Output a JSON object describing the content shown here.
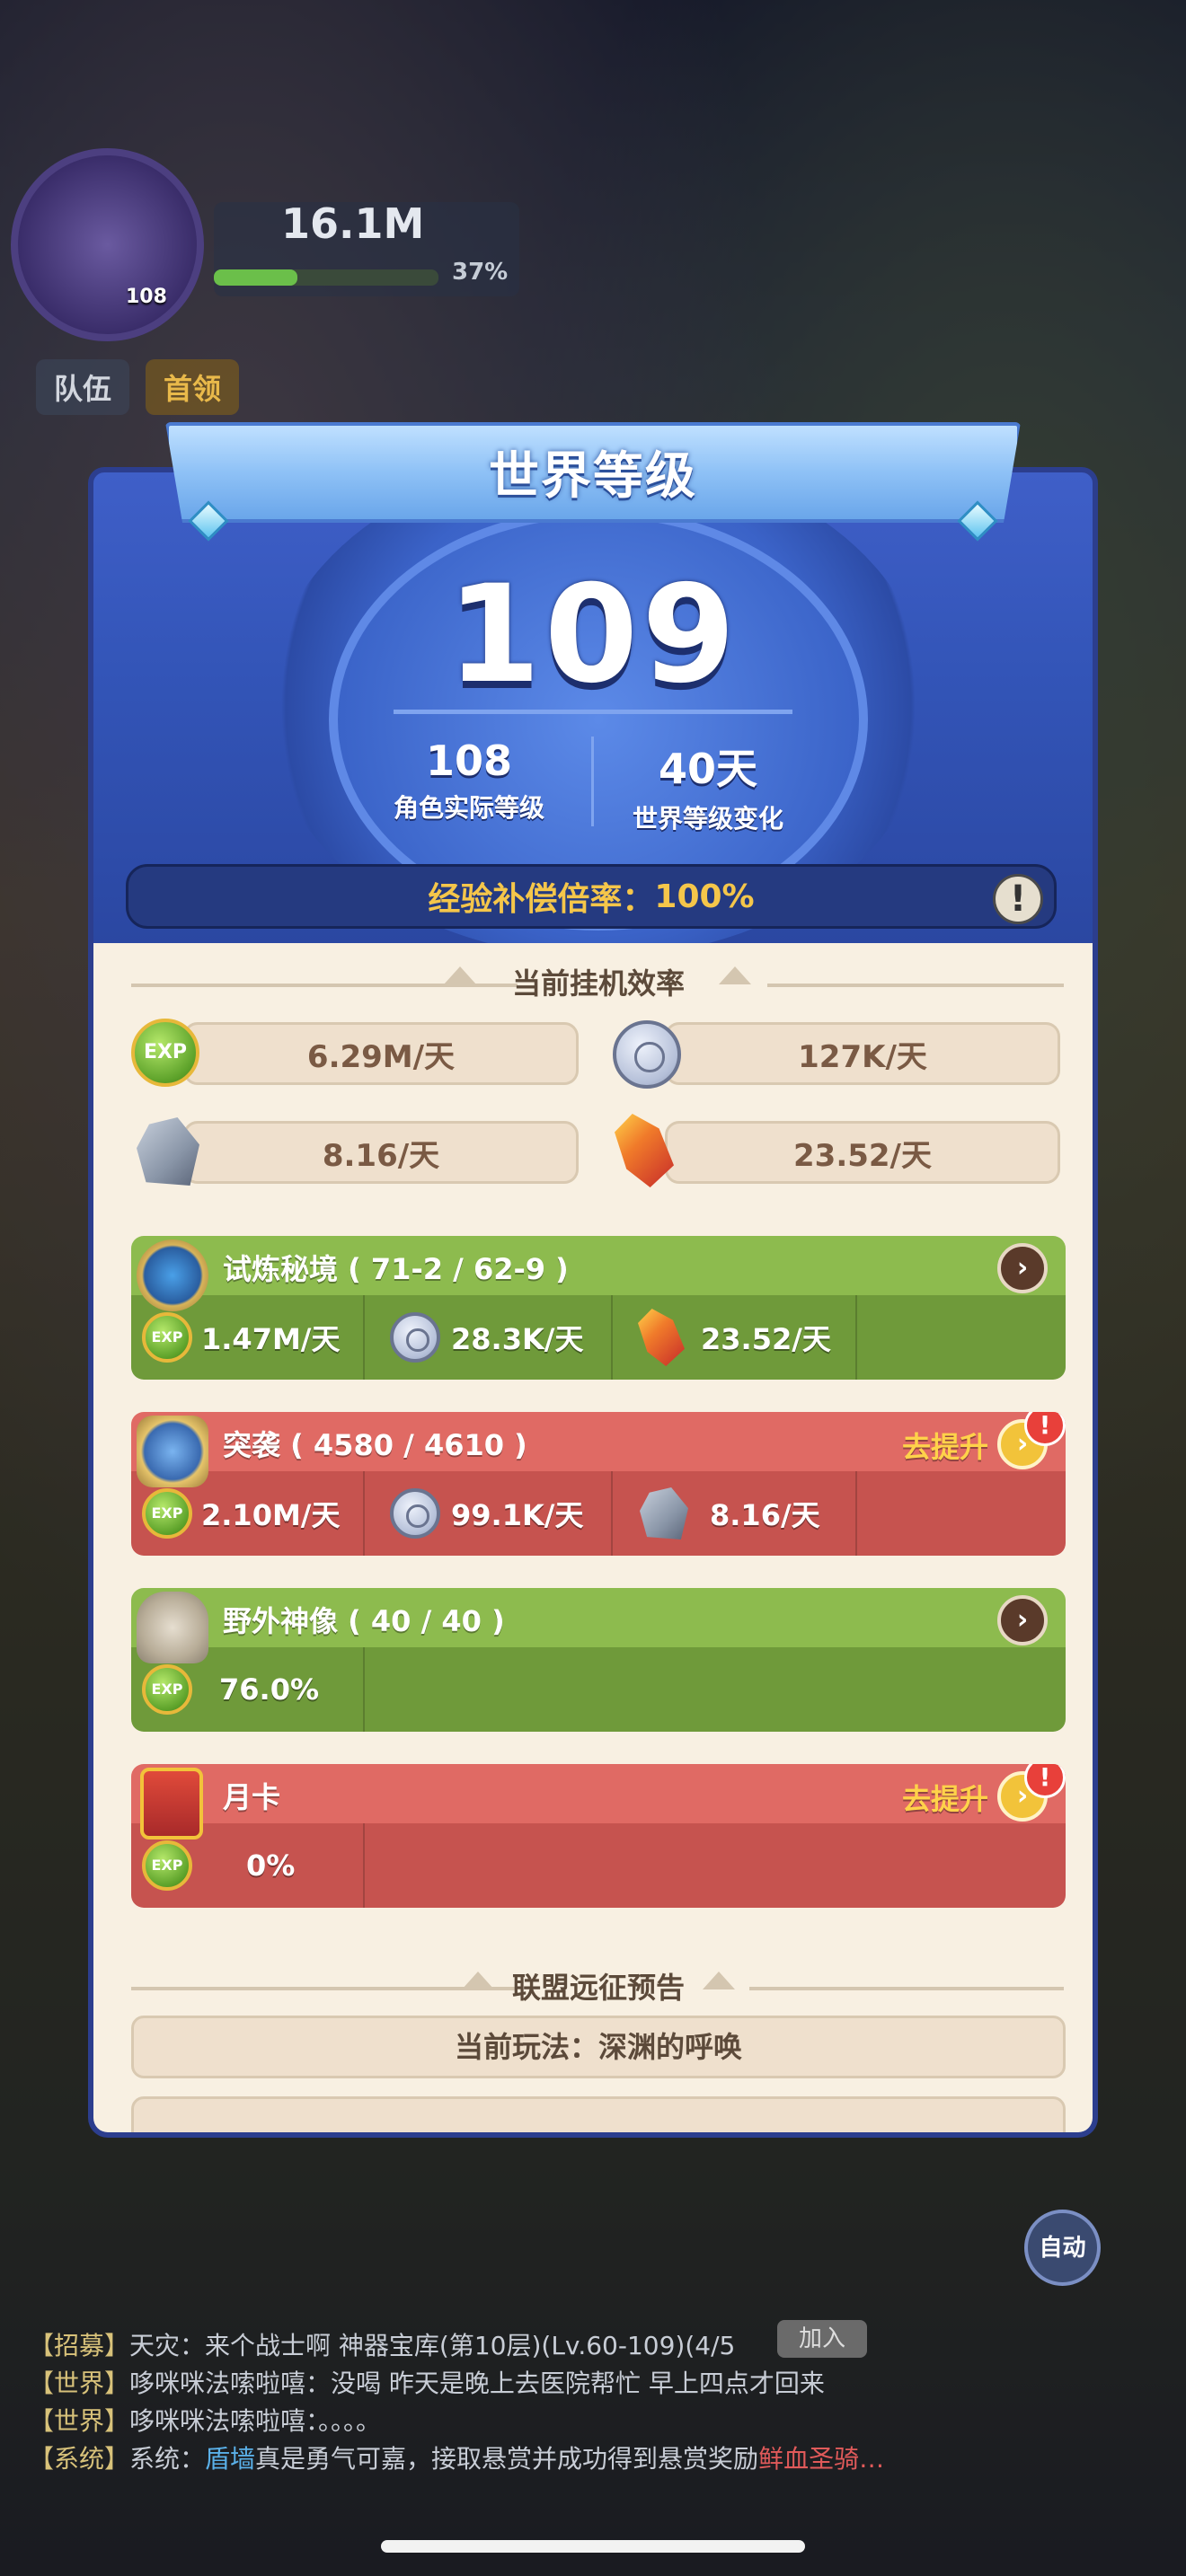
{
  "hud": {
    "power": "16.1M",
    "power_progress_label": "37%",
    "power_progress": 0.37,
    "avatar_level": "108",
    "tabs": [
      "队伍",
      "首领"
    ]
  },
  "modal": {
    "title": "世界等级",
    "world_level": "109",
    "actual_level": {
      "value": "108",
      "label": "角色实际等级"
    },
    "level_change": {
      "value": "40天",
      "label": "世界等级变化"
    },
    "exp_comp": {
      "label": "经验补偿倍率：",
      "value": "100%"
    },
    "info_icon": "!",
    "efficiency_title": "当前挂机效率",
    "rates": {
      "exp": "6.29M/天",
      "coin": "127K/天",
      "ore": "8.16/天",
      "crystal": "23.52/天"
    },
    "sources": [
      {
        "name": "试炼秘境 ( 71-2 / 62-9 )",
        "color": "green",
        "improve": "",
        "cells": [
          "1.47M/天",
          "28.3K/天",
          "23.52/天"
        ]
      },
      {
        "name": "突袭 ( 4580 / 4610 )",
        "color": "red",
        "improve": "去提升",
        "cells": [
          "2.10M/天",
          "99.1K/天",
          "8.16/天"
        ]
      },
      {
        "name": "野外神像 ( 40 / 40 )",
        "color": "green",
        "improve": "",
        "cells": [
          "76.0%"
        ]
      },
      {
        "name": "月卡",
        "color": "red",
        "improve": "去提升",
        "cells": [
          "0%"
        ]
      }
    ],
    "alliance_title": "联盟远征预告",
    "current_play": "当前玩法：深渊的呼唤",
    "exp_icon_text": "EXP"
  },
  "chat": [
    {
      "tag": "【招募】",
      "user": "天灾：",
      "text": "来个战士啊 神器宝库(第10层)(Lv.60-109)(4/5"
    },
    {
      "tag": "【世界】",
      "user": "哆咪咪法嗦啦嘻：",
      "text": "没喝   昨天是晚上去医院帮忙   早上四点才回来"
    },
    {
      "tag": "【世界】",
      "user": "哆咪咪法嗦啦嘻：",
      "text": "。。。。"
    },
    {
      "tag": "【系统】",
      "user": "系统：",
      "hl": "盾墙",
      "text": "真是勇气可嘉，接取悬赏并成功得到悬赏奖励",
      "red": "鲜血圣骑…"
    }
  ],
  "join_label": "加入",
  "auto_label": "自动",
  "colors": {
    "modal_blue": "#3355b8",
    "card_green": "#8dbb4e",
    "card_red": "#e06a64",
    "gold": "#f5c64a",
    "panel_bg": "#f8f0e2"
  }
}
